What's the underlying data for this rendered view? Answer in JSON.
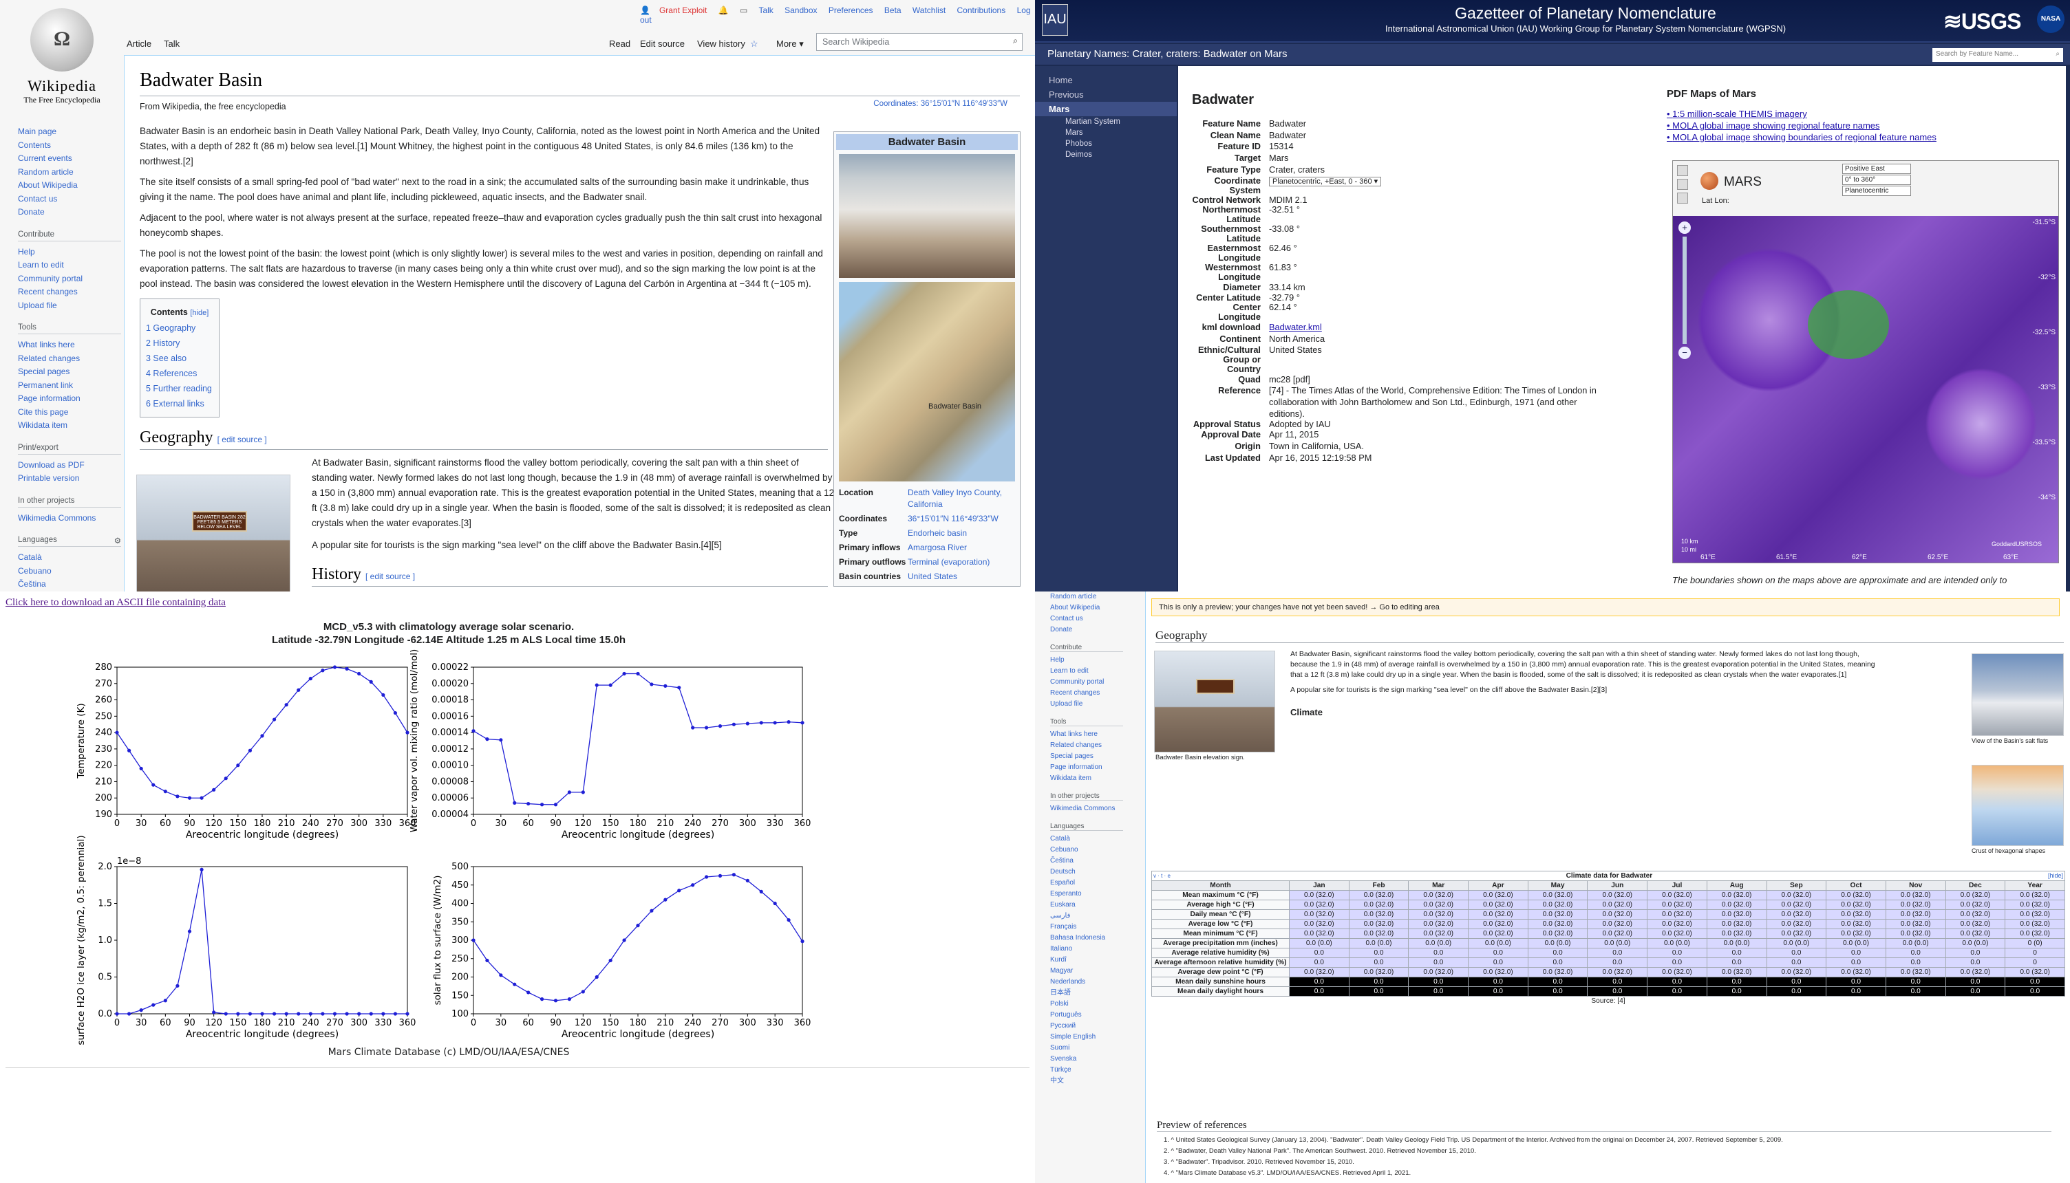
{
  "wiki": {
    "top_links": [
      "Grant Exploit",
      "Talk",
      "Sandbox",
      "Preferences",
      "Beta",
      "Watchlist",
      "Contributions",
      "Log out"
    ],
    "tabs": {
      "article": "Article",
      "talk": "Talk",
      "read": "Read",
      "edit_source": "Edit source",
      "view_history": "View history",
      "more": "More"
    },
    "search_placeholder": "Search Wikipedia",
    "logo_title": "Wikipedia",
    "logo_sub": "The Free Encyclopedia",
    "nav": [
      "Main page",
      "Contents",
      "Current events",
      "Random article",
      "About Wikipedia",
      "Contact us",
      "Donate"
    ],
    "contribute_h": "Contribute",
    "contribute": [
      "Help",
      "Learn to edit",
      "Community portal",
      "Recent changes",
      "Upload file"
    ],
    "tools_h": "Tools",
    "tools": [
      "What links here",
      "Related changes",
      "Special pages",
      "Permanent link",
      "Page information",
      "Cite this page",
      "Wikidata item"
    ],
    "print_h": "Print/export",
    "print": [
      "Download as PDF",
      "Printable version"
    ],
    "projects_h": "In other projects",
    "projects": [
      "Wikimedia Commons"
    ],
    "lang_h": "Languages",
    "langs": [
      "Català",
      "Cebuano",
      "Čeština"
    ],
    "title": "Badwater Basin",
    "from": "From Wikipedia, the free encyclopedia",
    "coords_top": "Coordinates: 36°15′01″N 116°49′33″W",
    "p1": "Badwater Basin is an endorheic basin in Death Valley National Park, Death Valley, Inyo County, California, noted as the lowest point in North America and the United States, with a depth of 282 ft (86 m) below sea level.[1] Mount Whitney, the highest point in the contiguous 48 United States, is only 84.6 miles (136 km) to the northwest.[2]",
    "p2": "The site itself consists of a small spring-fed pool of \"bad water\" next to the road in a sink; the accumulated salts of the surrounding basin make it undrinkable, thus giving it the name. The pool does have animal and plant life, including pickleweed, aquatic insects, and the Badwater snail.",
    "p3": "Adjacent to the pool, where water is not always present at the surface, repeated freeze–thaw and evaporation cycles gradually push the thin salt crust into hexagonal honeycomb shapes.",
    "p4": "The pool is not the lowest point of the basin: the lowest point (which is only slightly lower) is several miles to the west and varies in position, depending on rainfall and evaporation patterns. The salt flats are hazardous to traverse (in many cases being only a thin white crust over mud), and so the sign marking the low point is at the pool instead. The basin was considered the lowest elevation in the Western Hemisphere until the discovery of Laguna del Carbón in Argentina at −344 ft (−105 m).",
    "toc_title": "Contents",
    "toc_hide": "[hide]",
    "toc": [
      "1  Geography",
      "2  History",
      "3  See also",
      "4  References",
      "5  Further reading",
      "6  External links"
    ],
    "geo_h": "Geography",
    "edit_source": "[ edit source ]",
    "geo_p": "At Badwater Basin, significant rainstorms flood the valley bottom periodically, covering the salt pan with a thin sheet of standing water. Newly formed lakes do not last long though, because the 1.9 in (48 mm) of average rainfall is overwhelmed by a 150 in (3,800 mm) annual evaporation rate. This is the greatest evaporation potential in the United States, meaning that a 12 ft (3.8 m) lake could dry up in a single year. When the basin is flooded, some of the salt is dissolved; it is redeposited as clean crystals when the water evaporates.[3]",
    "geo_p2": "A popular site for tourists is the sign marking \"sea level\" on the cliff above the Badwater Basin.[4][5]",
    "hist_h": "History",
    "sign_text": "BADWATER BASIN 282 FEET/85.5 METERS BELOW SEA LEVEL",
    "infobox": {
      "title": "Badwater Basin",
      "map_label": "Badwater Basin",
      "rows": [
        [
          "Location",
          "Death Valley Inyo County, California"
        ],
        [
          "Coordinates",
          "36°15′01″N 116°49′33″W"
        ],
        [
          "Type",
          "Endorheic basin"
        ],
        [
          "Primary inflows",
          "Amargosa River"
        ],
        [
          "Primary outflows",
          "Terminal (evaporation)"
        ],
        [
          "Basin countries",
          "United States"
        ]
      ]
    }
  },
  "gaz": {
    "title": "Gazetteer of Planetary Nomenclature",
    "subtitle": "International Astronomical Union (IAU) Working Group for Planetary System Nomenclature (WGPSN)",
    "iau": "IAU",
    "usgs": "≋USGS",
    "nasa": "NASA",
    "bar": "Planetary Names: Crater, craters: Badwater on Mars",
    "search_placeholder": "Search by Feature Name...",
    "nav": [
      "Home",
      "Previous",
      "Mars"
    ],
    "subnav": [
      "Martian System",
      "Mars",
      "Phobos",
      "Deimos"
    ],
    "feature": "Badwater",
    "rows": [
      [
        "Feature Name",
        "Badwater"
      ],
      [
        "Clean Name",
        "Badwater"
      ],
      [
        "Feature ID",
        "15314"
      ],
      [
        "Target",
        "Mars"
      ],
      [
        "Feature Type",
        "Crater, craters"
      ],
      [
        "Coordinate System",
        "Planetocentric, +East, 0 - 360"
      ],
      [
        "Control Network",
        "MDIM 2.1"
      ],
      [
        "Northernmost Latitude",
        "-32.51 °"
      ],
      [
        "Southernmost Latitude",
        "-33.08 °"
      ],
      [
        "Easternmost Longitude",
        "62.46 °"
      ],
      [
        "Westernmost Longitude",
        "61.83 °"
      ],
      [
        "Diameter",
        "33.14 km"
      ],
      [
        "Center Latitude",
        "-32.79 °"
      ],
      [
        "Center Longitude",
        "62.14 °"
      ],
      [
        "kml download",
        "Badwater.kml"
      ],
      [
        "Continent",
        "North America"
      ],
      [
        "Ethnic/Cultural Group or Country",
        "United States"
      ],
      [
        "Quad",
        "mc28 [pdf]"
      ],
      [
        "Reference",
        "[74] - The Times Atlas of the World, Comprehensive Edition: The Times of London in collaboration with John Bartholomew and Son Ltd., Edinburgh, 1971 (and other editions)."
      ],
      [
        "Approval Status",
        "Adopted by IAU"
      ],
      [
        "Approval Date",
        "Apr 11, 2015"
      ],
      [
        "Origin",
        "Town in California, USA."
      ],
      [
        "Last Updated",
        "Apr 16, 2015 12:19:58 PM"
      ]
    ],
    "pdf_h": "PDF Maps of Mars",
    "pdf": [
      "1:5 million-scale THEMIS imagery",
      "MOLA global image showing regional feature names",
      "MOLA global image showing boundaries of regional feature names"
    ],
    "map": {
      "planet": "MARS",
      "latlon": "Lat Lon:",
      "sel1": "Positive East",
      "sel2": "0° to 360°",
      "sel3": "Planetocentric",
      "lat_ticks": [
        "-31.5°S",
        "-32°S",
        "-32.5°S",
        "-33°S",
        "-33.5°S",
        "-34°S"
      ],
      "lon_ticks": [
        "61°E",
        "61.5°E",
        "62°E",
        "62.5°E",
        "63°E"
      ],
      "scale": "10 km",
      "scale2": "10 mi",
      "credit": "GoddardUSRSOS"
    },
    "caption": "The boundaries shown on the maps above are approximate and are intended only to"
  },
  "mcd": {
    "download": "Click here to download an ASCII file containing data",
    "title1": "MCD_v5.3 with climatology average solar scenario.",
    "title2": "Latitude -32.79N Longitude -62.14E Altitude 1.25 m ALS Local time 15.0h",
    "footer": "Mars Climate Database (c) LMD/OU/IAA/ESA/CNES"
  },
  "chart_data": [
    {
      "type": "line",
      "ylabel": "Temperature (K)",
      "xlabel": "Areocentric longitude (degrees)",
      "xlim": [
        0,
        360
      ],
      "ylim": [
        190,
        280
      ],
      "yticks": [
        "190",
        "200",
        "210",
        "220",
        "230",
        "240",
        "250",
        "260",
        "270",
        "280"
      ],
      "x": [
        0,
        15,
        30,
        45,
        60,
        75,
        90,
        105,
        120,
        135,
        150,
        165,
        180,
        195,
        210,
        225,
        240,
        255,
        270,
        285,
        300,
        315,
        330,
        345,
        360
      ],
      "values": [
        240,
        229,
        218,
        208,
        204,
        201,
        200,
        200,
        205,
        212,
        220,
        229,
        238,
        248,
        257,
        266,
        273,
        278,
        280,
        279,
        276,
        271,
        263,
        252,
        240
      ]
    },
    {
      "type": "line",
      "ylabel": "Water vapor vol. mixing ratio (mol/mol)",
      "xlabel": "Areocentric longitude (degrees)",
      "xlim": [
        0,
        360
      ],
      "ylim": [
        4e-05,
        0.00022
      ],
      "yticks": [
        "0.00004",
        "0.00006",
        "0.00008",
        "0.00010",
        "0.00012",
        "0.00014",
        "0.00016",
        "0.00018",
        "0.00020",
        "0.00022"
      ],
      "x": [
        0,
        15,
        30,
        45,
        60,
        75,
        90,
        105,
        120,
        135,
        150,
        165,
        180,
        195,
        210,
        225,
        240,
        255,
        270,
        285,
        300,
        315,
        330,
        345,
        360
      ],
      "values": [
        0.000142,
        0.000132,
        0.000131,
        5.4e-05,
        5.3e-05,
        5.2e-05,
        5.2e-05,
        6.7e-05,
        6.7e-05,
        0.000198,
        0.000198,
        0.000212,
        0.000212,
        0.000199,
        0.000197,
        0.000195,
        0.000146,
        0.000146,
        0.000148,
        0.00015,
        0.000151,
        0.000152,
        0.000152,
        0.000153,
        0.000152
      ]
    },
    {
      "type": "line",
      "ylabel": "surface H2O ice layer (kg/m2, 0.5: perennial)",
      "xlabel": "Areocentric longitude (degrees)",
      "xlim": [
        0,
        360
      ],
      "ylim": [
        0,
        2
      ],
      "scale_label": "1e−8",
      "yticks": [
        "0.0",
        "0.5",
        "1.0",
        "1.5",
        "2.0"
      ],
      "x": [
        0,
        15,
        30,
        45,
        60,
        75,
        90,
        105,
        120,
        135,
        150,
        165,
        180,
        195,
        210,
        225,
        240,
        255,
        270,
        285,
        300,
        315,
        330,
        345,
        360
      ],
      "values": [
        0,
        0,
        0.05,
        0.12,
        0.18,
        0.38,
        1.12,
        1.96,
        0.02,
        0,
        0,
        0,
        0,
        0,
        0,
        0,
        0,
        0,
        0,
        0,
        0,
        0,
        0,
        0,
        0
      ]
    },
    {
      "type": "line",
      "ylabel": "solar flux to surface (W/m2)",
      "xlabel": "Areocentric longitude (degrees)",
      "xlim": [
        0,
        360
      ],
      "ylim": [
        100,
        500
      ],
      "yticks": [
        "100",
        "150",
        "200",
        "250",
        "300",
        "350",
        "400",
        "450",
        "500"
      ],
      "x": [
        0,
        15,
        30,
        45,
        60,
        75,
        90,
        105,
        120,
        135,
        150,
        165,
        180,
        195,
        210,
        225,
        240,
        255,
        270,
        285,
        300,
        315,
        330,
        345,
        360
      ],
      "values": [
        300,
        245,
        205,
        180,
        158,
        140,
        136,
        140,
        160,
        200,
        245,
        300,
        340,
        380,
        410,
        435,
        450,
        472,
        475,
        478,
        462,
        432,
        400,
        355,
        297
      ]
    }
  ],
  "preview": {
    "warning": "This is only a preview; your changes have not yet been saved! → Go to editing area",
    "geo_h": "Geography",
    "climate_h": "Climate",
    "geo_p": "At Badwater Basin, significant rainstorms flood the valley bottom periodically, covering the salt pan with a thin sheet of standing water. Newly formed lakes do not last long though, because the 1.9 in (48 mm) of average rainfall is overwhelmed by a 150 in (3,800 mm) annual evaporation rate. This is the greatest evaporation potential in the United States, meaning that a 12 ft (3.8 m) lake could dry up in a single year. When the basin is flooded, some of the salt is dissolved; it is redeposited as clean crystals when the water evaporates.[1]",
    "geo_p2": "A popular site for tourists is the sign marking \"sea level\" on the cliff above the Badwater Basin.[2][3]",
    "cap1": "Badwater Basin elevation sign.",
    "cap2": "View of the Basin's salt flats",
    "cap3": "Crust of hexagonal shapes",
    "side": [
      "Random article",
      "About Wikipedia",
      "Contact us",
      "Donate",
      "Contribute",
      "Help",
      "Learn to edit",
      "Community portal",
      "Recent changes",
      "Upload file",
      "Tools",
      "What links here",
      "Related changes",
      "Special pages",
      "Page information",
      "Wikidata item",
      "In other projects",
      "Wikimedia Commons",
      "Languages",
      "Català",
      "Cebuano",
      "Čeština",
      "Deutsch",
      "Español",
      "Esperanto",
      "Euskara",
      "فارسی",
      "Français",
      "Bahasa Indonesia",
      "Italiano",
      "Kurdî",
      "Magyar",
      "Nederlands",
      "日本語",
      "Polski",
      "Português",
      "Русский",
      "Simple English",
      "Suomi",
      "Svenska",
      "Türkçe",
      "中文"
    ],
    "clim_title": "Climate data for Badwater",
    "clim_vte": "v · t · e",
    "clim_hide": "[hide]",
    "months": [
      "Month",
      "Jan",
      "Feb",
      "Mar",
      "Apr",
      "May",
      "Jun",
      "Jul",
      "Aug",
      "Sep",
      "Oct",
      "Nov",
      "Dec",
      "Year"
    ],
    "rowlabels": [
      "Mean maximum °C (°F)",
      "Average high °C (°F)",
      "Daily mean °C (°F)",
      "Average low °C (°F)",
      "Mean minimum °C (°F)",
      "Average precipitation mm (inches)",
      "Average relative humidity (%)",
      "Average afternoon relative humidity (%)",
      "Average dew point °C (°F)",
      "Mean daily sunshine hours",
      "Mean daily daylight hours"
    ],
    "temp_cell": "0.0 (32.0)",
    "precip_cell": "0.0 (0.0)",
    "rh_cell": "0.0",
    "year_precip": "0 (0)",
    "sun_cell": "0.0",
    "source": "Source: [4]",
    "refs_h": "Preview of references",
    "refs": [
      "1. ^ United States Geological Survey (January 13, 2004). \"Badwater\". Death Valley Geology Field Trip. US Department of the Interior. Archived from the original on December 24, 2007. Retrieved September 5, 2009.",
      "2. ^ \"Badwater, Death Valley National Park\". The American Southwest. 2010. Retrieved November 15, 2010.",
      "3. ^ \"Badwater\". Tripadvisor. 2010. Retrieved November 15, 2010.",
      "4. ^ \"Mars Climate Database v5.3\". LMD/OU/IAA/ESA/CNES. Retrieved April 1, 2021."
    ]
  }
}
